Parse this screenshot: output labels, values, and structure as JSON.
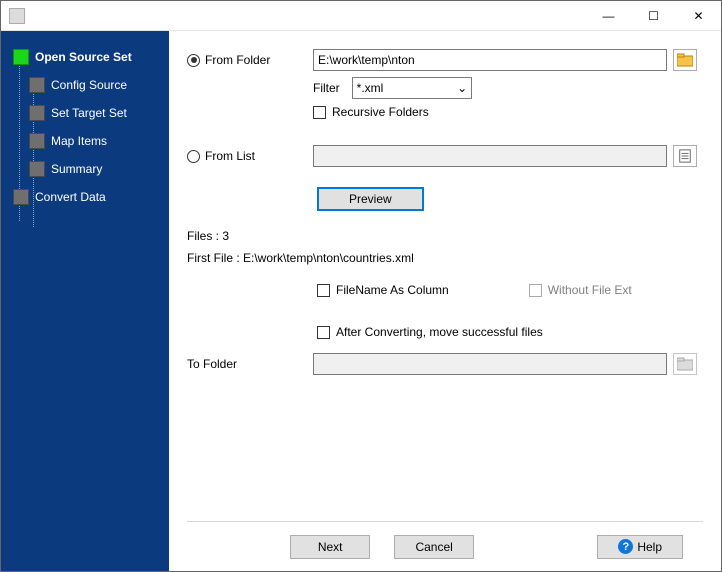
{
  "titlebar": {
    "min": "—",
    "max": "☐",
    "close": "✕"
  },
  "sidebar": {
    "items": [
      {
        "label": "Open Source Set",
        "active": true,
        "child": false
      },
      {
        "label": "Config Source",
        "active": false,
        "child": true
      },
      {
        "label": "Set Target Set",
        "active": false,
        "child": true
      },
      {
        "label": "Map Items",
        "active": false,
        "child": true
      },
      {
        "label": "Summary",
        "active": false,
        "child": true
      },
      {
        "label": "Convert Data",
        "active": false,
        "child": false
      }
    ]
  },
  "form": {
    "from_folder_label": "From Folder",
    "from_folder_value": "E:\\work\\temp\\nton",
    "filter_label": "Filter",
    "filter_value": "*.xml",
    "recursive_label": "Recursive Folders",
    "from_list_label": "From List",
    "from_list_value": "",
    "preview_btn": "Preview",
    "files_count_line": "Files : 3",
    "first_file_line": "First File : E:\\work\\temp\\nton\\countries.xml",
    "filename_col_label": "FileName As Column",
    "without_ext_label": "Without File Ext",
    "after_conv_label": "After Converting, move successful files",
    "to_folder_label": "To Folder",
    "to_folder_value": ""
  },
  "buttons": {
    "next": "Next",
    "cancel": "Cancel",
    "help": "Help"
  }
}
